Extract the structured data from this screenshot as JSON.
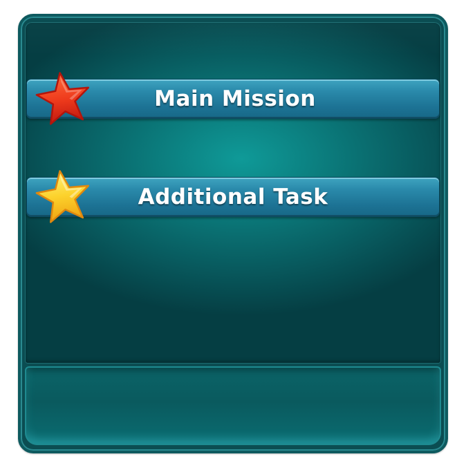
{
  "missions": {
    "main_label": "Main Mission",
    "additional_label": "Additional Task"
  },
  "icons": {
    "main": "red-star-icon",
    "additional": "yellow-star-icon"
  },
  "colors": {
    "panel_teal": "#0b7a7b",
    "bar_blue": "#2a8aab",
    "star_red": "#e8321c",
    "star_yellow": "#f7c21a"
  }
}
